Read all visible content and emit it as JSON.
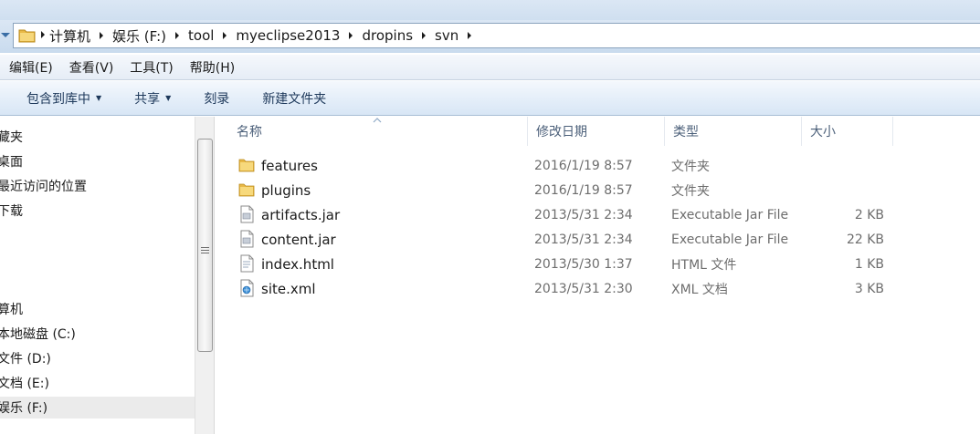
{
  "breadcrumb": [
    "计算机",
    "娱乐 (F:)",
    "tool",
    "myeclipse2013",
    "dropins",
    "svn"
  ],
  "menu": [
    "编辑(E)",
    "查看(V)",
    "工具(T)",
    "帮助(H)"
  ],
  "commands": [
    {
      "label": "包含到库中",
      "has_dropdown": true
    },
    {
      "label": "共享",
      "has_dropdown": true
    },
    {
      "label": "刻录",
      "has_dropdown": false
    },
    {
      "label": "新建文件夹",
      "has_dropdown": false
    }
  ],
  "nav_items": [
    "藏夹",
    "桌面",
    "最近访问的位置",
    "下载",
    "",
    "",
    "算机",
    "本地磁盘 (C:)",
    "文件 (D:)",
    "文档 (E:)",
    "娱乐 (F:)"
  ],
  "nav_selected_index": 10,
  "columns": {
    "name": "名称",
    "date": "修改日期",
    "type": "类型",
    "size": "大小"
  },
  "files": [
    {
      "name": "features",
      "date": "2016/1/19 8:57",
      "type": "文件夹",
      "size": "",
      "icon": "folder-icon"
    },
    {
      "name": "plugins",
      "date": "2016/1/19 8:57",
      "type": "文件夹",
      "size": "",
      "icon": "folder-icon"
    },
    {
      "name": "artifacts.jar",
      "date": "2013/5/31 2:34",
      "type": "Executable Jar File",
      "size": "2 KB",
      "icon": "jar-file-icon"
    },
    {
      "name": "content.jar",
      "date": "2013/5/31 2:34",
      "type": "Executable Jar File",
      "size": "22 KB",
      "icon": "jar-file-icon"
    },
    {
      "name": "index.html",
      "date": "2013/5/30 1:37",
      "type": "HTML 文件",
      "size": "1 KB",
      "icon": "html-file-icon"
    },
    {
      "name": "site.xml",
      "date": "2013/5/31 2:30",
      "type": "XML 文档",
      "size": "3 KB",
      "icon": "xml-file-icon"
    }
  ],
  "colors": {
    "chrome": "#dbe7f4",
    "command_text": "#1e395b",
    "header_text": "#4c607a",
    "folder": "#e8b846"
  }
}
